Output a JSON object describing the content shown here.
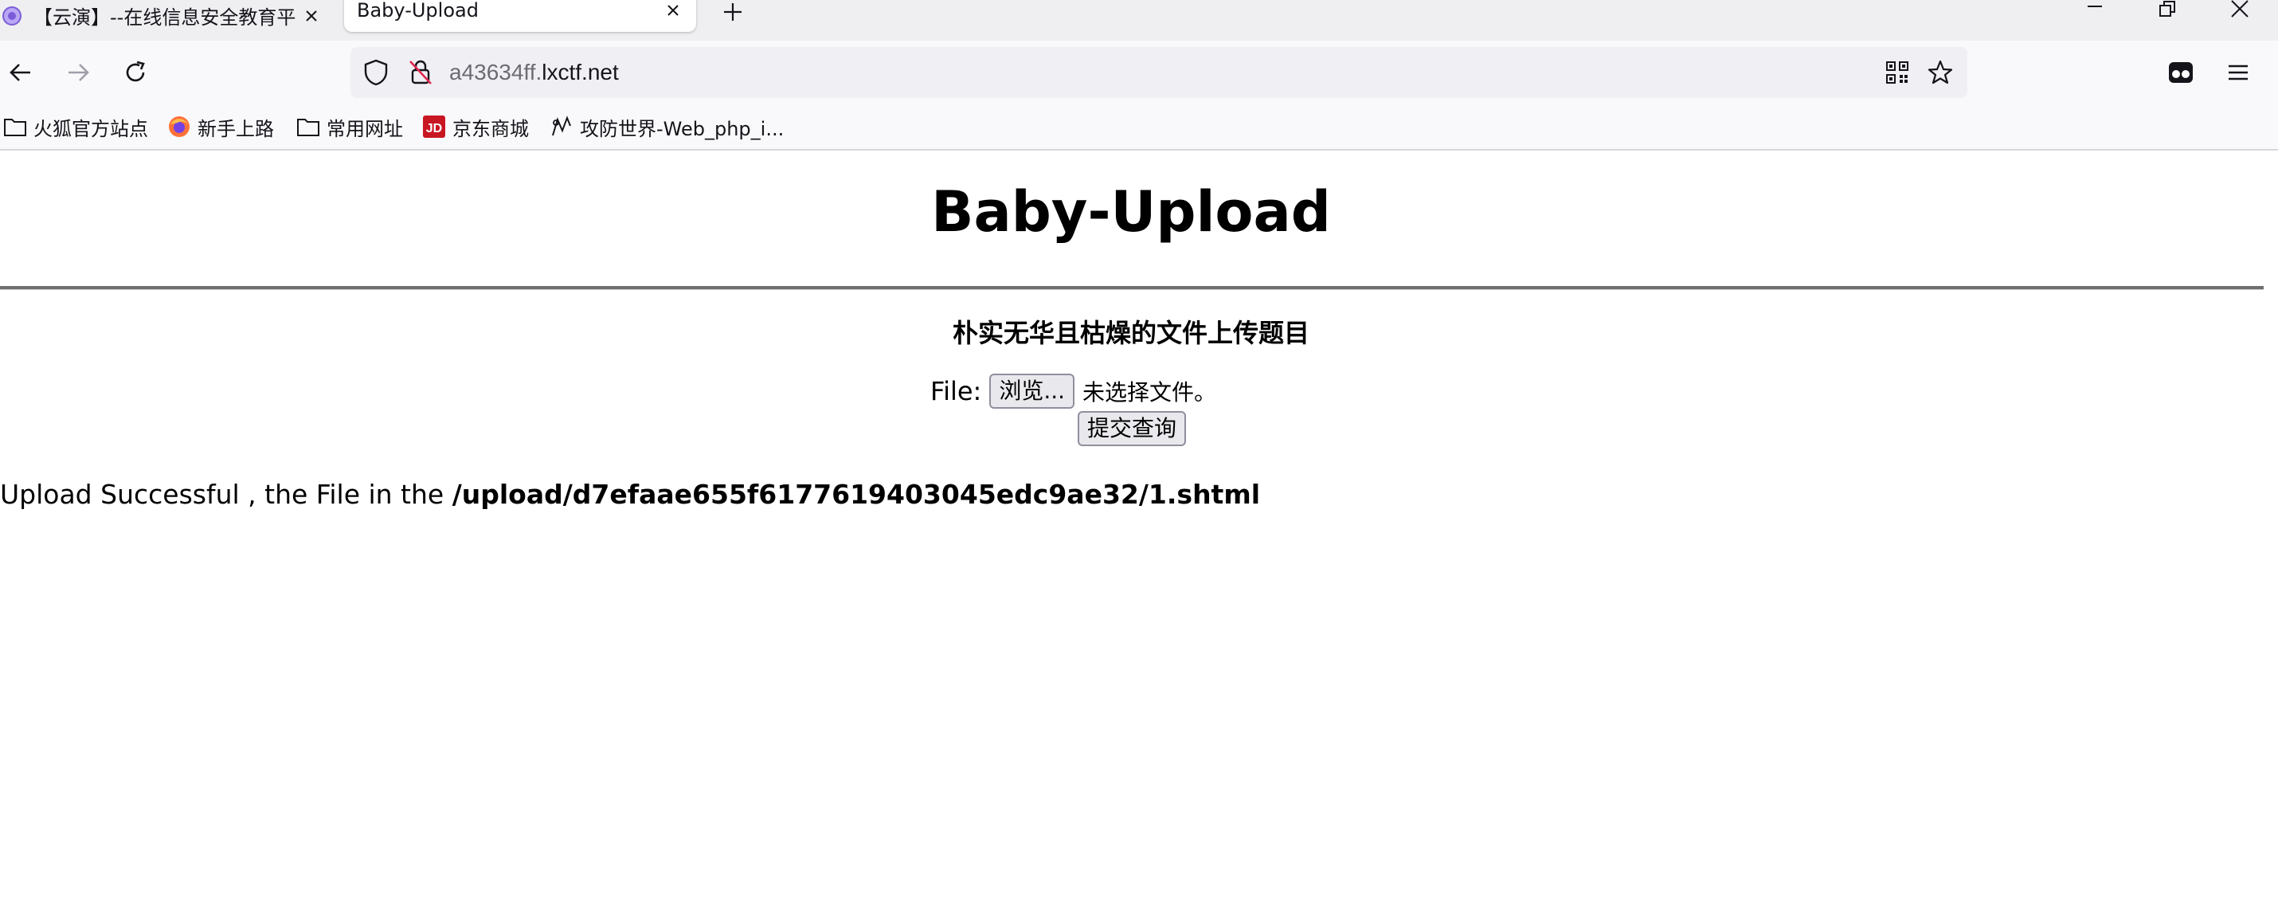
{
  "browser": {
    "tabs": [
      {
        "title": "【云演】--在线信息安全教育平",
        "active": false
      },
      {
        "title": "Baby-Upload",
        "active": true
      }
    ],
    "address": {
      "dim_part": "a43634ff.",
      "main_part": "lxctf.net"
    },
    "bookmarks": [
      {
        "label": "火狐官方站点",
        "icon": "folder-icon"
      },
      {
        "label": "新手上路",
        "icon": "firefox-icon"
      },
      {
        "label": "常用网址",
        "icon": "folder-icon"
      },
      {
        "label": "京东商城",
        "icon": "jd-icon"
      },
      {
        "label": "攻防世界-Web_php_i...",
        "icon": "adworld-icon"
      }
    ],
    "colors": {
      "jd_red": "#c91623",
      "firefox_orange": "#ff7139"
    }
  },
  "page": {
    "title": "Baby-Upload",
    "subtitle": "朴实无华且枯燥的文件上传题目",
    "file_label": "File:",
    "browse_label": "浏览...",
    "no_file_text": "未选择文件。",
    "submit_label": "提交查询",
    "result_prefix": "Upload Successful , the File in the ",
    "result_path": "/upload/d7efaae655f6177619403045edc9ae32/1.shtml"
  }
}
